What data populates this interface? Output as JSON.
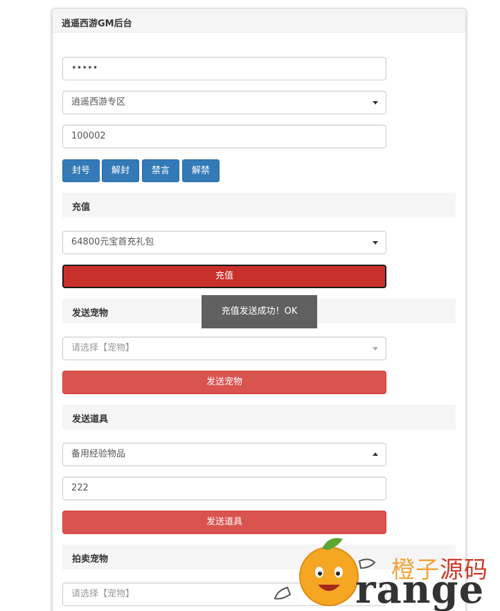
{
  "panel": {
    "title": "逍遥西游GM后台"
  },
  "form": {
    "password_value": "•••••",
    "server_select": "逍遥西游专区",
    "role_id_value": "100002"
  },
  "actions": [
    "封号",
    "解封",
    "禁言",
    "解禁"
  ],
  "recharge": {
    "section_title": "充值",
    "package_select": "64800元宝首充礼包",
    "button_label": "充值"
  },
  "pet": {
    "section_title": "发送宠物",
    "select_placeholder": "请选择【宠物】",
    "button_label": "发送宠物"
  },
  "item": {
    "section_title": "发送道具",
    "item_select": "备用经验物品",
    "quantity_value": "222",
    "button_label": "发送道具"
  },
  "auction": {
    "section_title": "拍卖宠物",
    "select_placeholder": "请选择【宠物】"
  },
  "toast": {
    "message": "充值发送成功！OK"
  },
  "watermark": {
    "cn_part1": "橙子",
    "cn_part2": "源码",
    "en": "range"
  },
  "colors": {
    "primary": "#337ab7",
    "danger": "#d9534f",
    "danger_active": "#c9302c",
    "toast_bg": "#606060"
  }
}
